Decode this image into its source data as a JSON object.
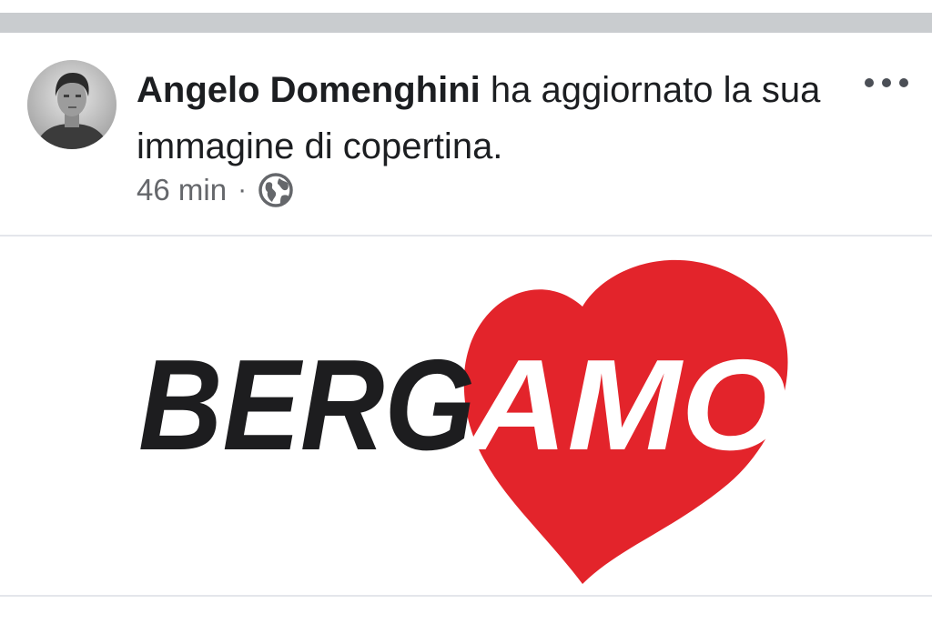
{
  "post": {
    "author": "Angelo Domenghini",
    "action_text": "ha aggiornato la sua immagine di copertina.",
    "timestamp": "46 min",
    "separator": "·",
    "privacy_icon": "globe-icon",
    "more_icon": "more-options-icon"
  },
  "cover_image": {
    "logo_text_dark": "BERG",
    "logo_text_light": "AMO",
    "heart_color": "#e3242b",
    "dark_text_color": "#1d1d1f"
  }
}
